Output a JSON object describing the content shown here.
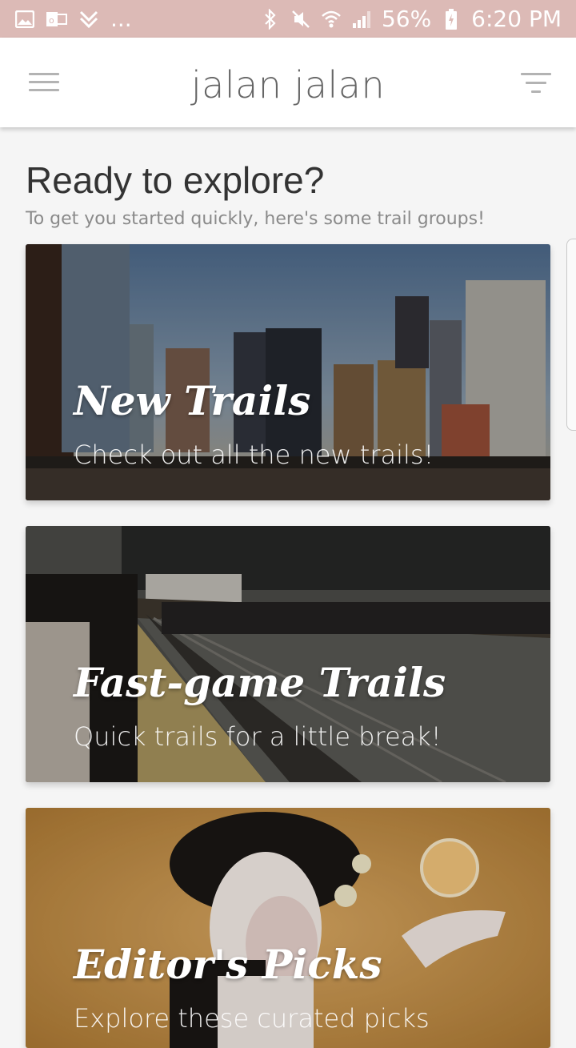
{
  "status_bar": {
    "left_icons": [
      "gallery-icon",
      "outlook-icon",
      "download-icon"
    ],
    "overflow": "...",
    "battery": "56%",
    "time": "6:20 PM"
  },
  "app_bar": {
    "title": "jalan jalan"
  },
  "intro": {
    "title": "Ready to explore?",
    "subtitle": "To get you started quickly, here's some trail groups!"
  },
  "cards": [
    {
      "title": "New Trails",
      "subtitle": "Check out all the new trails!"
    },
    {
      "title": "Fast-game Trails",
      "subtitle": "Quick trails for a little break!"
    },
    {
      "title": "Editor's Picks",
      "subtitle": "Explore these curated picks"
    }
  ],
  "colors": {
    "status_bar": "#dcbab6",
    "app_bar": "#ffffff",
    "background": "#f5f5f5"
  }
}
